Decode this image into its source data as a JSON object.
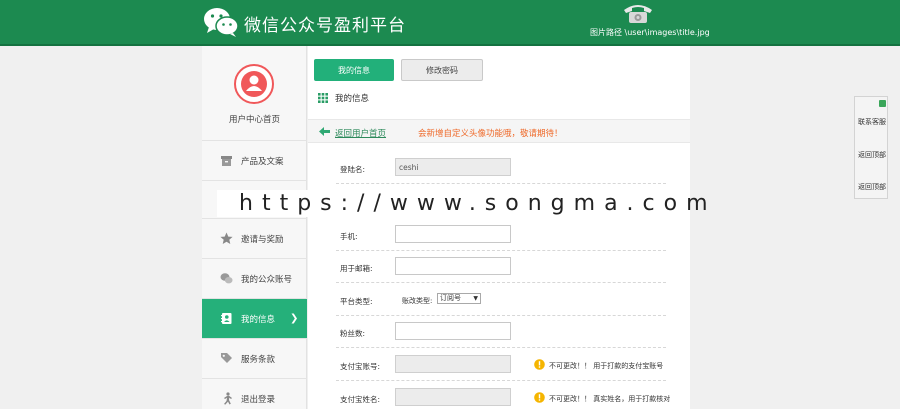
{
  "header": {
    "site_title": "微信公众号盈利平台",
    "image_path_caption": "图片路径 \\user\\images\\title.jpg"
  },
  "sidebar": {
    "home_label": "用户中心首页",
    "items": [
      {
        "label": "产品及文案",
        "icon": "box-icon"
      },
      {
        "label": "",
        "icon": "unknown-icon"
      },
      {
        "label": "邀请与奖励",
        "icon": "star-icon"
      },
      {
        "label": "我的公众账号",
        "icon": "chat-bubbles-icon"
      },
      {
        "label": "我的信息",
        "icon": "contact-book-icon",
        "active": true
      },
      {
        "label": "服务条款",
        "icon": "tag-icon"
      },
      {
        "label": "退出登录",
        "icon": "running-man-icon"
      }
    ],
    "active_chevron": "❯"
  },
  "main": {
    "tabs": [
      {
        "label": "我的信息",
        "active": true
      },
      {
        "label": "修改密码",
        "active": false
      }
    ],
    "section_title": "我的信息",
    "back_link": "返回用户首页",
    "notice": "会新增自定义头像功能哦，敬请期待！",
    "form": {
      "username_label": "登陆名:",
      "username_value": "ceshi",
      "phone_label": "手机:",
      "email_label": "用于邮箱:",
      "platform_label": "平台类型:",
      "platform_sub_label": "账改类型:",
      "platform_select_value": "订阅号",
      "fans_label": "粉丝数:",
      "alipay_label": "支付宝账号:",
      "alipay_warning": "不可更改！！ 用于打款的支付宝账号",
      "payee_label": "支付宝姓名:",
      "payee_warning": "不可更改！！ 真实姓名，用于打款核对"
    }
  },
  "float_panel": {
    "items": [
      "联系客服",
      "返回顶部",
      "返回顶部"
    ]
  },
  "watermark": "https://www.songma.com",
  "colors": {
    "header_green": "#1c8a50",
    "accent_green": "#22b07a",
    "notice_orange": "#ef6a2a",
    "avatar_red": "#f0585a",
    "warning_yellow": "#f5b500"
  }
}
